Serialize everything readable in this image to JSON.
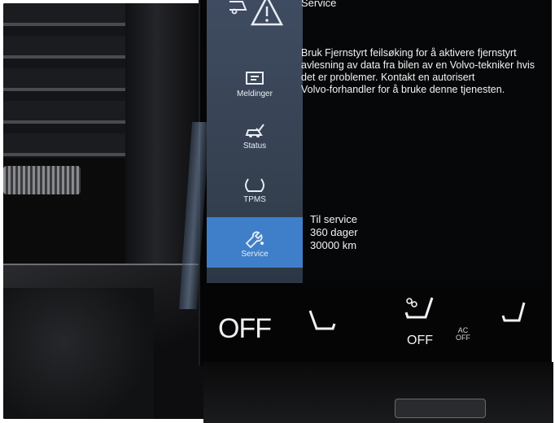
{
  "header": {
    "title": "Service"
  },
  "sidebar": {
    "items": [
      {
        "label": "",
        "icon": "warning-triangle-icon"
      },
      {
        "label": "Meldinger",
        "icon": "message-icon"
      },
      {
        "label": "Status",
        "icon": "car-check-icon"
      },
      {
        "label": "TPMS",
        "icon": "tire-pressure-icon"
      },
      {
        "label": "Service",
        "icon": "wrench-icon",
        "active": true
      }
    ]
  },
  "main": {
    "info_text": "Bruk Fjernstyrt feilsøking for å aktivere fjernstyrt\navlesning av data fra bilen av en Volvo-tekniker hvis\ndet er problemer. Kontakt en autorisert\nVolvo-forhandler for å bruke denne tjenesten.",
    "service": {
      "title": "Til service",
      "days": "360 dager",
      "distance": "30000 km"
    }
  },
  "climate": {
    "fan_off_label": "OFF",
    "seat_heat_off_label": "OFF",
    "ac_label": "AC",
    "ac_off_label": "OFF"
  },
  "colors": {
    "sidebar": "#3a4659",
    "active_item": "#3f7fc9",
    "screen_bg": "#060708",
    "text": "#f2f2f2"
  }
}
